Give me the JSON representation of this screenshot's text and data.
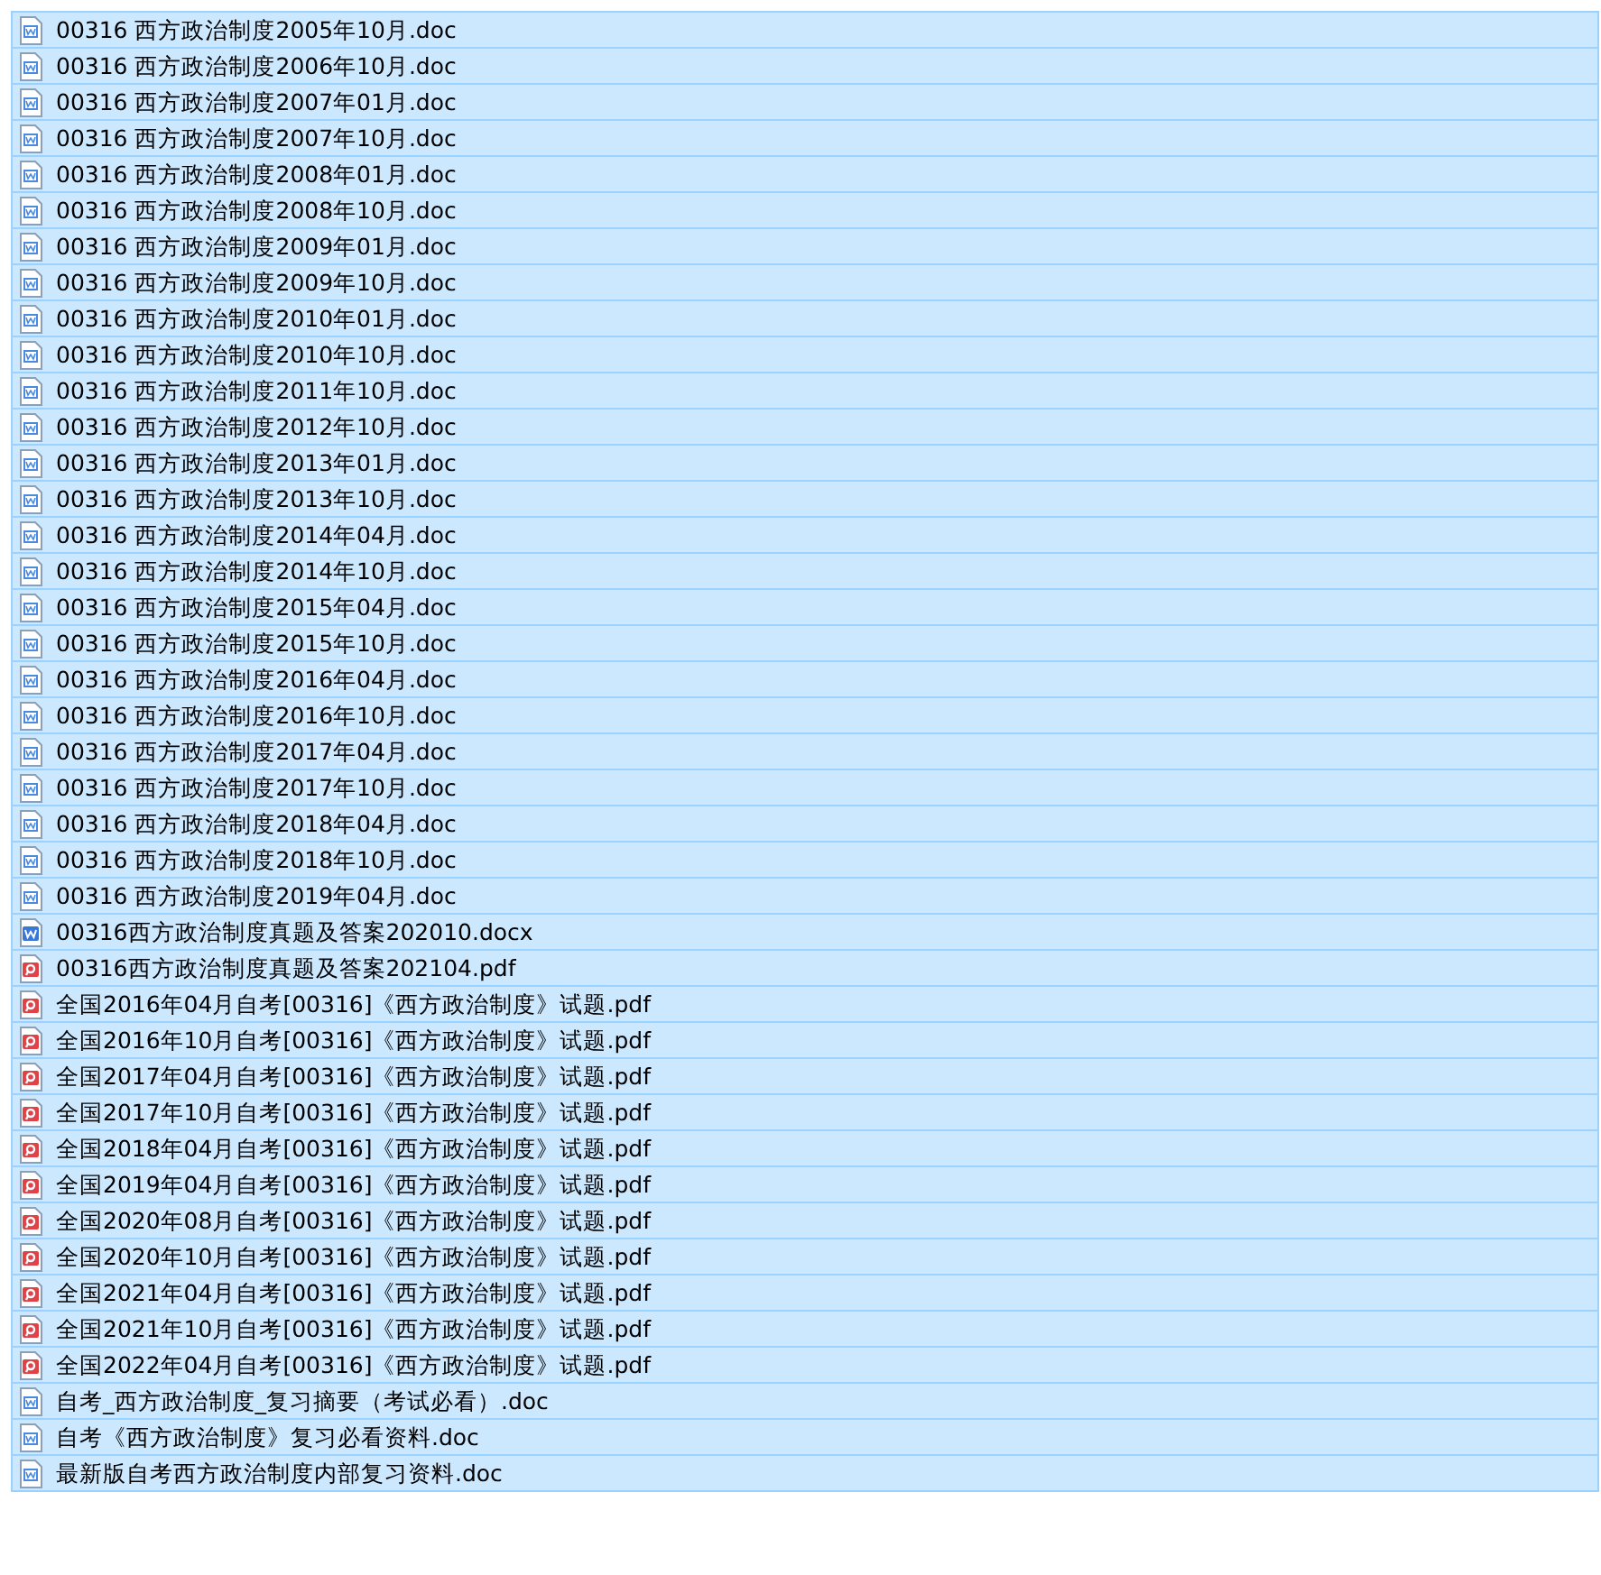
{
  "files": [
    {
      "name": "00316 西方政治制度2005年10月.doc",
      "kind": "doc",
      "selected": true
    },
    {
      "name": "00316 西方政治制度2006年10月.doc",
      "kind": "doc",
      "selected": true
    },
    {
      "name": "00316 西方政治制度2007年01月.doc",
      "kind": "doc",
      "selected": true
    },
    {
      "name": "00316 西方政治制度2007年10月.doc",
      "kind": "doc",
      "selected": true
    },
    {
      "name": "00316 西方政治制度2008年01月.doc",
      "kind": "doc",
      "selected": true
    },
    {
      "name": "00316 西方政治制度2008年10月.doc",
      "kind": "doc",
      "selected": true
    },
    {
      "name": "00316 西方政治制度2009年01月.doc",
      "kind": "doc",
      "selected": true
    },
    {
      "name": "00316 西方政治制度2009年10月.doc",
      "kind": "doc",
      "selected": true
    },
    {
      "name": "00316 西方政治制度2010年01月.doc",
      "kind": "doc",
      "selected": true
    },
    {
      "name": "00316 西方政治制度2010年10月.doc",
      "kind": "doc",
      "selected": true
    },
    {
      "name": "00316 西方政治制度2011年10月.doc",
      "kind": "doc",
      "selected": true
    },
    {
      "name": "00316 西方政治制度2012年10月.doc",
      "kind": "doc",
      "selected": true
    },
    {
      "name": "00316 西方政治制度2013年01月.doc",
      "kind": "doc",
      "selected": true
    },
    {
      "name": "00316 西方政治制度2013年10月.doc",
      "kind": "doc",
      "selected": true
    },
    {
      "name": "00316 西方政治制度2014年04月.doc",
      "kind": "doc",
      "selected": true
    },
    {
      "name": "00316 西方政治制度2014年10月.doc",
      "kind": "doc",
      "selected": true
    },
    {
      "name": "00316 西方政治制度2015年04月.doc",
      "kind": "doc",
      "selected": true
    },
    {
      "name": "00316 西方政治制度2015年10月.doc",
      "kind": "doc",
      "selected": true
    },
    {
      "name": "00316 西方政治制度2016年04月.doc",
      "kind": "doc",
      "selected": true
    },
    {
      "name": "00316 西方政治制度2016年10月.doc",
      "kind": "doc",
      "selected": true
    },
    {
      "name": "00316 西方政治制度2017年04月.doc",
      "kind": "doc",
      "selected": true
    },
    {
      "name": "00316 西方政治制度2017年10月.doc",
      "kind": "doc",
      "selected": true
    },
    {
      "name": "00316 西方政治制度2018年04月.doc",
      "kind": "doc",
      "selected": true
    },
    {
      "name": "00316 西方政治制度2018年10月.doc",
      "kind": "doc",
      "selected": true
    },
    {
      "name": "00316 西方政治制度2019年04月.doc",
      "kind": "doc",
      "selected": true
    },
    {
      "name": "00316西方政治制度真题及答案202010.docx",
      "kind": "docx",
      "selected": true
    },
    {
      "name": "00316西方政治制度真题及答案202104.pdf",
      "kind": "pdf",
      "selected": true
    },
    {
      "name": "全国2016年04月自考[00316]《西方政治制度》试题.pdf",
      "kind": "pdf",
      "selected": true
    },
    {
      "name": "全国2016年10月自考[00316]《西方政治制度》试题.pdf",
      "kind": "pdf",
      "selected": true
    },
    {
      "name": "全国2017年04月自考[00316]《西方政治制度》试题.pdf",
      "kind": "pdf",
      "selected": true
    },
    {
      "name": "全国2017年10月自考[00316]《西方政治制度》试题.pdf",
      "kind": "pdf",
      "selected": true
    },
    {
      "name": "全国2018年04月自考[00316]《西方政治制度》试题.pdf",
      "kind": "pdf",
      "selected": true
    },
    {
      "name": "全国2019年04月自考[00316]《西方政治制度》试题.pdf",
      "kind": "pdf",
      "selected": true
    },
    {
      "name": "全国2020年08月自考[00316]《西方政治制度》试题.pdf",
      "kind": "pdf",
      "selected": true
    },
    {
      "name": "全国2020年10月自考[00316]《西方政治制度》试题.pdf",
      "kind": "pdf",
      "selected": true
    },
    {
      "name": "全国2021年04月自考[00316]《西方政治制度》试题.pdf",
      "kind": "pdf",
      "selected": true
    },
    {
      "name": "全国2021年10月自考[00316]《西方政治制度》试题.pdf",
      "kind": "pdf",
      "selected": true
    },
    {
      "name": "全国2022年04月自考[00316]《西方政治制度》试题.pdf",
      "kind": "pdf",
      "selected": true
    },
    {
      "name": "自考_西方政治制度_复习摘要（考试必看）.doc",
      "kind": "doc",
      "selected": true
    },
    {
      "name": "自考《西方政治制度》复习必看资料.doc",
      "kind": "doc",
      "selected": true
    },
    {
      "name": "最新版自考西方政治制度内部复习资料.doc",
      "kind": "doc",
      "selected": true
    }
  ]
}
